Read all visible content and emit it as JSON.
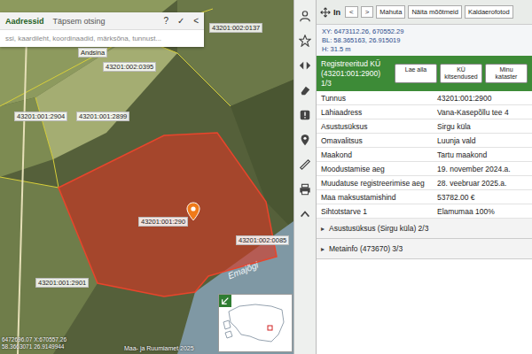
{
  "search": {
    "tabs": [
      {
        "label": "Aadressid",
        "selected": true
      },
      {
        "label": "Täpsem otsing",
        "selected": false
      }
    ],
    "actions": [
      "?",
      "✓",
      "<"
    ],
    "placeholder": "ssi, kaardileht, koordinaadid, märksõna, tunnust..."
  },
  "map": {
    "labels": [
      "43201:002:0137",
      "Andsina",
      "43201:002:0395",
      "43201:001:2904",
      "43201:001:2899",
      "43201:001:290",
      "43201:001:2901",
      "43201:002:0085"
    ],
    "river": "Emajõgi",
    "coords": [
      "6472696.07 X:670557.26",
      "58.3663071 26.9149944"
    ],
    "attribution": "Maa- ja Ruumiamet 2025"
  },
  "panel": {
    "title": "In",
    "nav": [
      "<",
      ">"
    ],
    "buttons": [
      "Mahuta",
      "Näita mõõtmeid",
      "Kaldaerofotod"
    ],
    "position": [
      "XY: 6473112.26, 670552.29",
      "BL: 58.365163, 26.915019",
      "H: 31.5 m"
    ],
    "header": {
      "title": "Registreeritud KÜ (43201:001:2900) 1/3",
      "buttons": [
        "Lae alla",
        "KÜ kitsendused",
        "Minu kataster"
      ]
    },
    "rows": [
      {
        "label": "Tunnus",
        "value": "43201:001:2900"
      },
      {
        "label": "Lähiaadress",
        "value": "Vana-Kasepõllu tee 4"
      },
      {
        "label": "Asustusüksus",
        "value": "Sirgu küla"
      },
      {
        "label": "Omavalitsus",
        "value": "Luunja vald"
      },
      {
        "label": "Maakond",
        "value": "Tartu maakond"
      },
      {
        "label": "Moodustamise aeg",
        "value": "19. november 2024.a."
      },
      {
        "label": "Muudatuse registreerimise aeg",
        "value": "28. veebruar 2025.a."
      },
      {
        "label": "Maa maksustamishind",
        "value": "53782.00 €"
      },
      {
        "label": "Sihtotstarve 1",
        "value": "Elamumaa 100%"
      }
    ],
    "sections": [
      {
        "icon": "▸",
        "label": "Asustusüksus (Sirgu küla) 2/3",
        "expanded": false
      },
      {
        "icon": "▸",
        "label": "Metainfo (473670) 3/3",
        "expanded": false
      }
    ]
  }
}
